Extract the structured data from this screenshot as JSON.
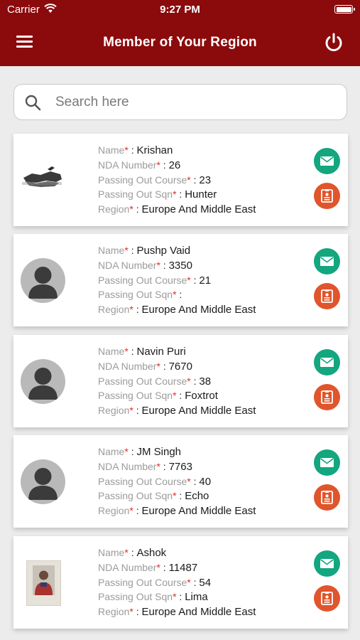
{
  "status_bar": {
    "carrier": "Carrier",
    "time": "9:27 PM"
  },
  "header": {
    "title": "Member of Your Region"
  },
  "search": {
    "placeholder": "Search here",
    "value": ""
  },
  "field_labels": {
    "name": "Name",
    "nda": "NDA Number",
    "course": "Passing Out Course",
    "sqn": "Passing Out Sqn",
    "region": "Region",
    "required_mark": "*",
    "separator": " : "
  },
  "members": [
    {
      "name": "Krishan",
      "nda": "26",
      "course": "23",
      "sqn": "Hunter",
      "region": "Europe And Middle East",
      "photo": "landscape-photo"
    },
    {
      "name": "Pushp Vaid",
      "nda": "3350",
      "course": "21",
      "sqn": "",
      "region": "Europe And Middle East",
      "photo": "default-avatar"
    },
    {
      "name": "Navin Puri",
      "nda": "7670",
      "course": "38",
      "sqn": "Foxtrot",
      "region": "Europe And Middle East",
      "photo": "default-avatar"
    },
    {
      "name": "JM Singh",
      "nda": "7763",
      "course": "40",
      "sqn": "Echo",
      "region": "Europe And Middle East",
      "photo": "default-avatar"
    },
    {
      "name": "Ashok",
      "nda": "11487",
      "course": "54",
      "sqn": "Lima",
      "region": "Europe And Middle East",
      "photo": "id-photo"
    }
  ],
  "icons": {
    "menu": "hamburger-menu-icon",
    "power": "power-icon",
    "search": "search-icon",
    "mail": "mail-icon",
    "id_card": "id-card-icon"
  },
  "colors": {
    "header_bg": "#8b0a0c",
    "mail_button": "#13a67f",
    "id_button": "#e0552c",
    "required_mark": "#e42b2b"
  }
}
